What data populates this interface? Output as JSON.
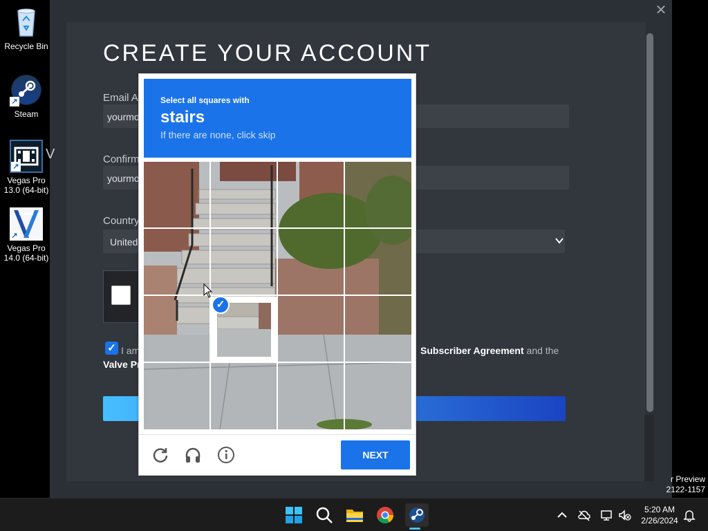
{
  "desktop": {
    "icons": [
      {
        "label": "Recycle Bin"
      },
      {
        "label": "Steam"
      },
      {
        "label": "Vegas Pro 13.0 (64-bit)"
      },
      {
        "label": "Vegas Pro 14.0 (64-bit)"
      }
    ],
    "corner_text_1": "r Preview",
    "corner_text_2": "2122-1157",
    "partial_text": "V"
  },
  "steam": {
    "title": "CREATE YOUR ACCOUNT",
    "email_label": "Email Ac",
    "email_value": "yourmo",
    "confirm_label": "Confirm",
    "confirm_value": "yourmo",
    "country_label": "Country",
    "country_value": "United",
    "agree_start": "I am",
    "agree_link1": "Subscriber Agreement",
    "agree_mid": "and the",
    "agree_link2": "Valve Pr",
    "close_glyph": "✕"
  },
  "captcha": {
    "prompt_pre": "Select all squares with",
    "prompt_word": "stairs",
    "prompt_sub": "If there are none, click skip",
    "next_label": "NEXT",
    "selected_cells": [
      7
    ],
    "icons": [
      "reload-icon",
      "audio-icon",
      "info-icon"
    ]
  },
  "taskbar": {
    "time": "5:20 AM",
    "date": "2/26/2024",
    "apps": [
      "start",
      "search",
      "file-explorer",
      "chrome",
      "steam"
    ]
  },
  "colors": {
    "accent": "#1a73e8",
    "steam_bg": "#2b2f36"
  }
}
